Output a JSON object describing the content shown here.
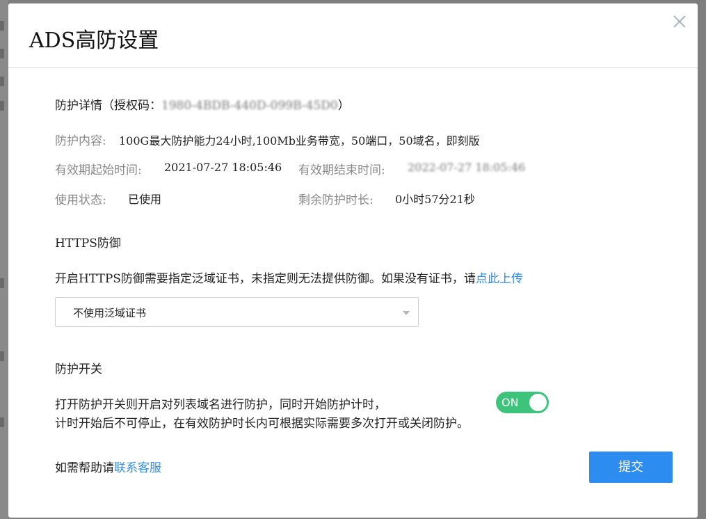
{
  "dialog": {
    "title": "ADS高防设置"
  },
  "details": {
    "heading_prefix": "防护详情（授权码：",
    "auth_code": "1980-4BDB-440D-099B-45D0",
    "heading_suffix": "）",
    "content_label": "防护内容:",
    "content_value": "100G最大防护能力24小时,100Mb业务带宽，50端口，50域名，即刻版",
    "start_label": "有效期起始时间:",
    "start_value": "2021-07-27 18:05:46",
    "end_label": "有效期结束时间:",
    "end_value": "2022-07-27 18:05:46",
    "status_label": "使用状态:",
    "status_value": "已使用",
    "remain_label": "剩余防护时长:",
    "remain_value": "0小时57分21秒"
  },
  "https": {
    "heading": "HTTPS防御",
    "desc": "开启HTTPS防御需要指定泛域证书，未指定则无法提供防御。如果没有证书，请",
    "link": "点此上传",
    "select_value": "不使用泛域证书"
  },
  "protect": {
    "heading": "防护开关",
    "desc_line1": "打开防护开关则开启对列表域名进行防护，同时开始防护计时，",
    "desc_line2": "计时开始后不可停止，在有效防护时长内可根据实际需要多次打开或关闭防护。",
    "toggle_label": "ON",
    "toggle_on": true
  },
  "footer": {
    "help_prefix": "如需帮助请",
    "help_link": "联系客服",
    "submit_label": "提交"
  },
  "colors": {
    "accent": "#2d8cf0",
    "toggle_on": "#3ec47a"
  }
}
